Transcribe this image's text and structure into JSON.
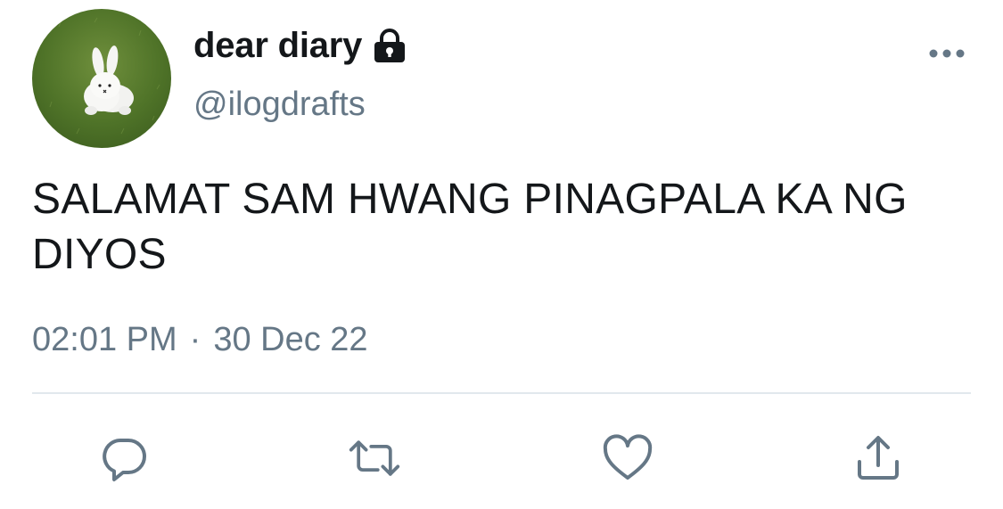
{
  "user": {
    "display_name": "dear diary",
    "handle": "@ilogdrafts",
    "protected_icon": "lock-icon",
    "avatar_icon": "bunny-avatar"
  },
  "tweet": {
    "text": "SALAMAT SAM HWANG PINAGPALA KA NG DIYOS",
    "time": "02:01 PM",
    "separator": "·",
    "date": "30 Dec 22"
  },
  "actions": [
    {
      "name": "reply",
      "icon": "reply-icon"
    },
    {
      "name": "retweet",
      "icon": "retweet-icon"
    },
    {
      "name": "like",
      "icon": "heart-icon"
    },
    {
      "name": "share",
      "icon": "share-icon"
    }
  ],
  "colors": {
    "primary_text": "#14171a",
    "secondary_text": "#657786",
    "divider": "#e1e8ed",
    "icon": "#657786"
  }
}
